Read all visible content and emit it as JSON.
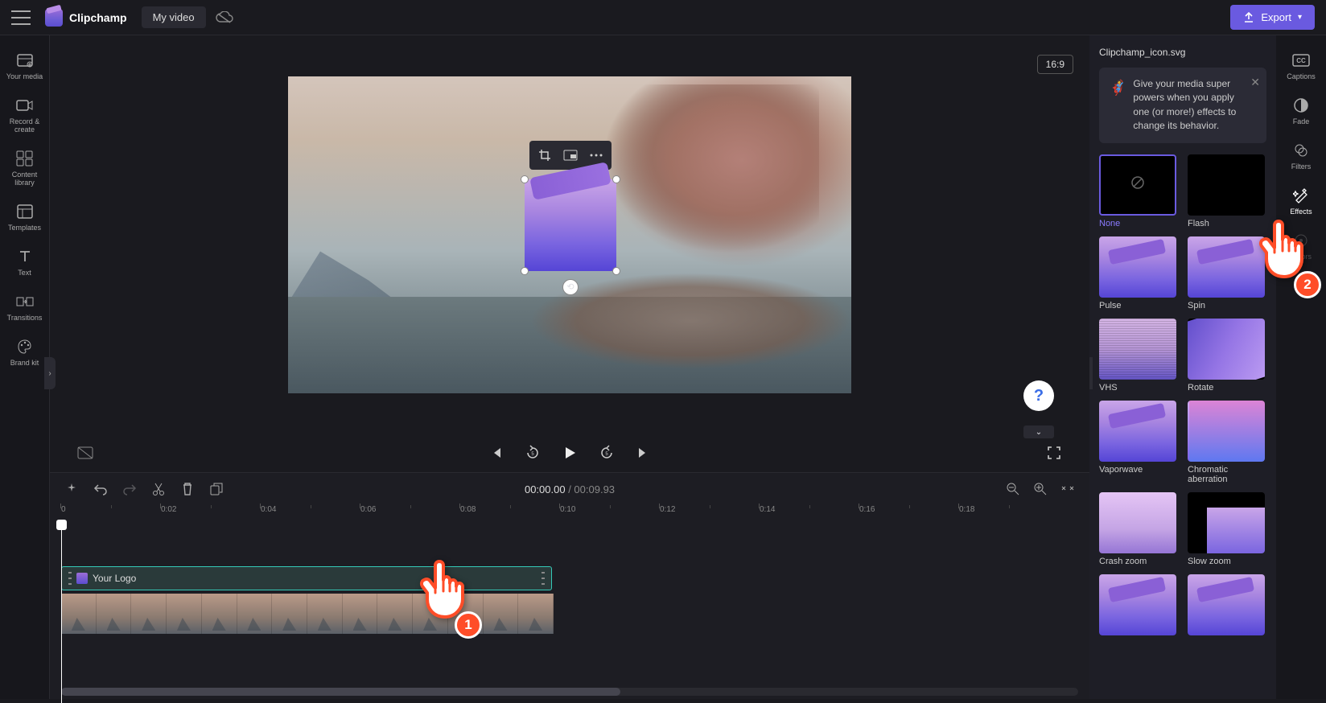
{
  "topbar": {
    "brand": "Clipchamp",
    "project_name": "My video",
    "export_label": "Export"
  },
  "left_rail": {
    "items": [
      {
        "label": "Your media"
      },
      {
        "label": "Record & create"
      },
      {
        "label": "Content library"
      },
      {
        "label": "Templates"
      },
      {
        "label": "Text"
      },
      {
        "label": "Transitions"
      },
      {
        "label": "Brand kit"
      }
    ]
  },
  "preview": {
    "aspect": "16:9"
  },
  "timeline": {
    "current": "00:00.00",
    "duration": "00:09.93",
    "ruler": [
      "0",
      "0:02",
      "0:04",
      "0:06",
      "0:08",
      "0:10",
      "0:12",
      "0:14",
      "0:16",
      "0:18"
    ],
    "logo_clip_label": "Your Logo"
  },
  "effects_panel": {
    "title": "Clipchamp_icon.svg",
    "tip": "Give your media super powers when you apply one (or more!) effects to change its behavior.",
    "effects": [
      {
        "label": "None",
        "selected": true,
        "style": "none"
      },
      {
        "label": "Flash",
        "style": "flash"
      },
      {
        "label": "Pulse",
        "style": "purple"
      },
      {
        "label": "Spin",
        "style": "purple"
      },
      {
        "label": "VHS",
        "style": "vhs"
      },
      {
        "label": "Rotate",
        "style": "rotate"
      },
      {
        "label": "Vaporwave",
        "style": "vapor"
      },
      {
        "label": "Chromatic aberration",
        "style": "chrom"
      },
      {
        "label": "Crash zoom",
        "style": "crash"
      },
      {
        "label": "Slow zoom",
        "style": "slow"
      },
      {
        "label": "",
        "style": "purple"
      },
      {
        "label": "",
        "style": "purple"
      }
    ]
  },
  "right_rail": {
    "items": [
      {
        "label": "Captions"
      },
      {
        "label": "Fade"
      },
      {
        "label": "Filters"
      },
      {
        "label": "Effects",
        "active": true
      },
      {
        "label": "Colors"
      }
    ]
  },
  "annotations": {
    "pointer1": "1",
    "pointer2": "2"
  }
}
